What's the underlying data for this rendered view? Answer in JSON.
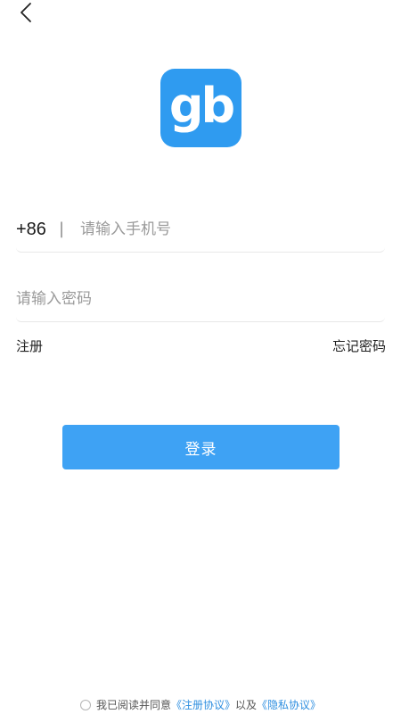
{
  "header": {
    "back_icon": "chevron-left-icon"
  },
  "logo": {
    "text": "gb",
    "color": "#2f9bf0"
  },
  "phone": {
    "country_code": "+86",
    "separator": "|",
    "placeholder": "请输入手机号",
    "value": ""
  },
  "password": {
    "placeholder": "请输入密码",
    "value": ""
  },
  "links": {
    "register": "注册",
    "forgot_password": "忘记密码"
  },
  "login_button": {
    "label": "登录",
    "color": "#3ea2f4"
  },
  "agreement": {
    "checked": false,
    "prefix": "我已阅读并同意",
    "register_agreement": "《注册协议》",
    "conjunction": "以及",
    "privacy_agreement": "《隐私协议》",
    "link_color": "#2f8fe0"
  }
}
